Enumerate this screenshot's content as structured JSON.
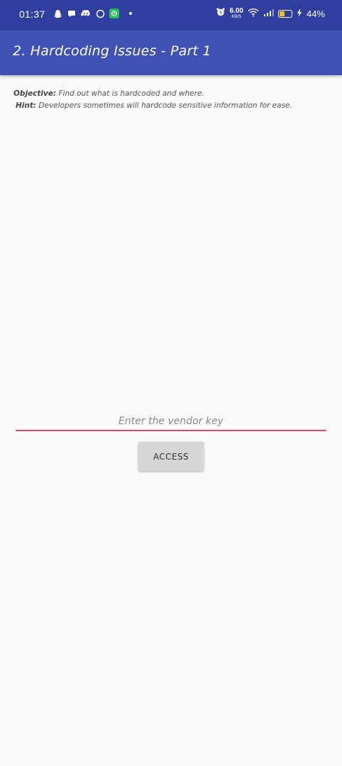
{
  "status_bar": {
    "time": "01:37",
    "notification_icons": [
      "snapchat-icon",
      "chat-bubble-icon",
      "discord-icon",
      "whatsapp-icon",
      "app-badge-icon"
    ],
    "net_speed_value": "6.00",
    "net_speed_unit": "KB/S",
    "battery_percent_text": "44%",
    "battery_level": 0.44,
    "battery_color": "#f0c419"
  },
  "toolbar": {
    "title": "2. Hardcoding Issues - Part 1",
    "color": "#3f51b5"
  },
  "content": {
    "objective_label": "Objective:",
    "objective_text": " Find out what is hardcoded and where.",
    "hint_label": "Hint:",
    "hint_text": " Developers sometimes will hardcode sensitive information for ease."
  },
  "form": {
    "vendor_key_value": "",
    "vendor_key_placeholder": "Enter the vendor key",
    "access_label": "ACCESS",
    "accent_color": "#e0467a"
  }
}
